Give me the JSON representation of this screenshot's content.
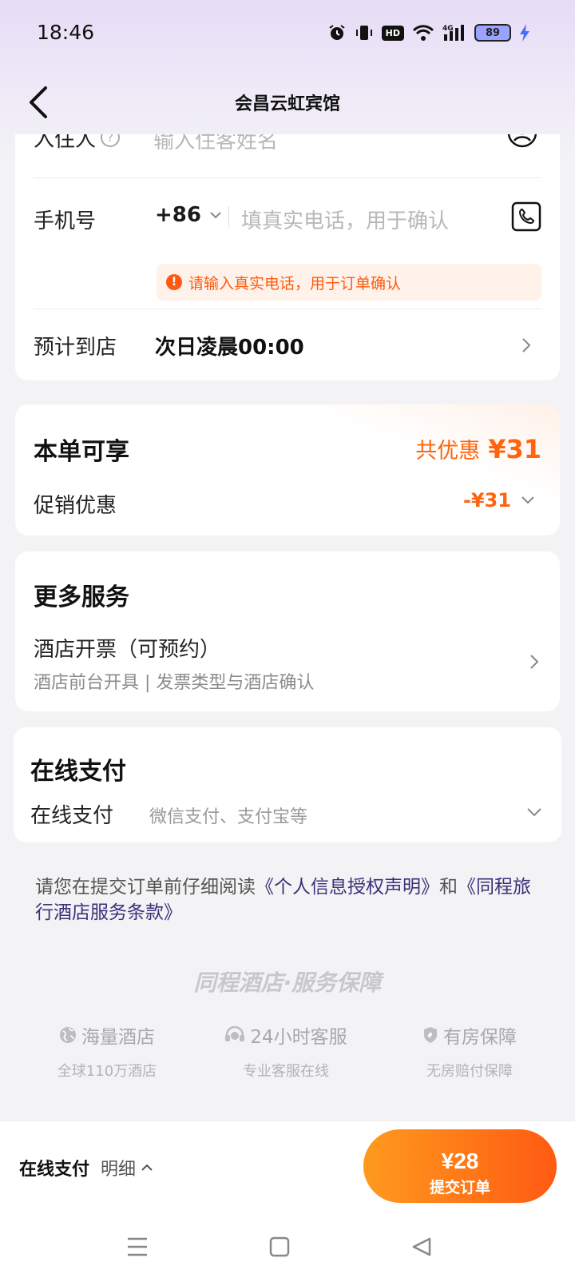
{
  "status_bar": {
    "time": "18:46",
    "battery": "89",
    "network": "4G",
    "hd": "HD"
  },
  "header": {
    "title": "会昌云虹宾馆"
  },
  "guest_card": {
    "guest_label": "入住人",
    "guest_placeholder": "输入住客姓名",
    "phone_label": "手机号",
    "country_code": "+86",
    "phone_placeholder": "填真实电话，用于确认",
    "phone_warning": "请输入真实电话，用于订单确认",
    "arrival_label": "预计到店",
    "arrival_value": "次日凌晨00:00"
  },
  "discount_card": {
    "title": "本单可享",
    "total_label": "共优惠",
    "total_amount": "¥31",
    "promo_label": "促销优惠",
    "promo_amount": "-¥31"
  },
  "services_card": {
    "title": "更多服务",
    "invoice_label": "酒店开票（可预约）",
    "invoice_sub": "酒店前台开具 | 发票类型与酒店确认"
  },
  "payment_card": {
    "title": "在线支付",
    "method_label": "在线支付",
    "method_value": "微信支付、支付宝等"
  },
  "agreement": {
    "prefix": "请您在提交订单前仔细阅读",
    "link1": "《个人信息授权声明》",
    "middle": "和",
    "link2": "《同程旅行酒店服务条款》"
  },
  "guarantee": {
    "title": "同程酒店·服务保障",
    "items": [
      {
        "head": "海量酒店",
        "sub": "全球110万酒店",
        "icon": "globe-icon"
      },
      {
        "head": "24小时客服",
        "sub": "专业客服在线",
        "icon": "headset-icon"
      },
      {
        "head": "有房保障",
        "sub": "无房赔付保障",
        "icon": "shield-icon"
      }
    ]
  },
  "bottom_bar": {
    "pay_label": "在线支付",
    "detail_label": "明细",
    "submit_price": "¥28",
    "submit_label": "提交订单"
  },
  "colors": {
    "accent": "#ff6410",
    "warning_bg": "#fff2ea",
    "link": "#3d2f7a"
  }
}
